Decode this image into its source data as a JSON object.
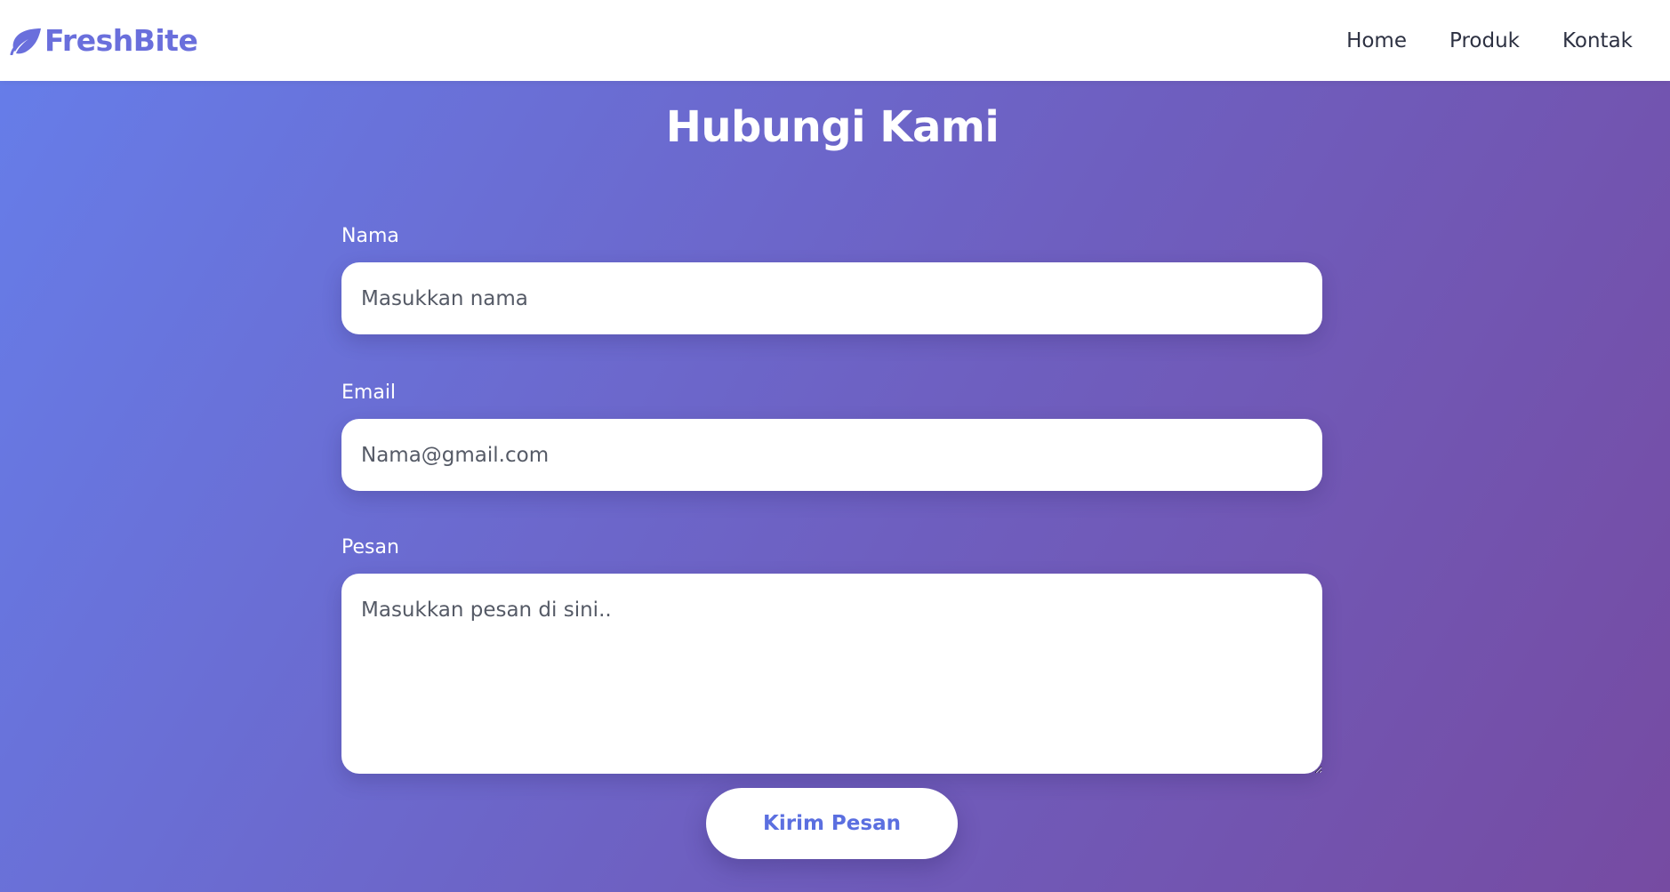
{
  "header": {
    "brand": "FreshBite",
    "brand_icon": "leaf-icon",
    "brand_color": "#6a6fdc",
    "nav": [
      {
        "label": "Home"
      },
      {
        "label": "Produk"
      },
      {
        "label": "Kontak"
      }
    ]
  },
  "main": {
    "title": "Hubungi Kami",
    "background_gradient": [
      "#667eea",
      "#764ba2"
    ],
    "form": {
      "name_label": "Nama",
      "name_placeholder": "Masukkan nama",
      "email_label": "Email",
      "email_placeholder": "Nama@gmail.com",
      "message_label": "Pesan",
      "message_placeholder": "Masukkan pesan di sini..",
      "submit_label": "Kirim Pesan"
    }
  }
}
